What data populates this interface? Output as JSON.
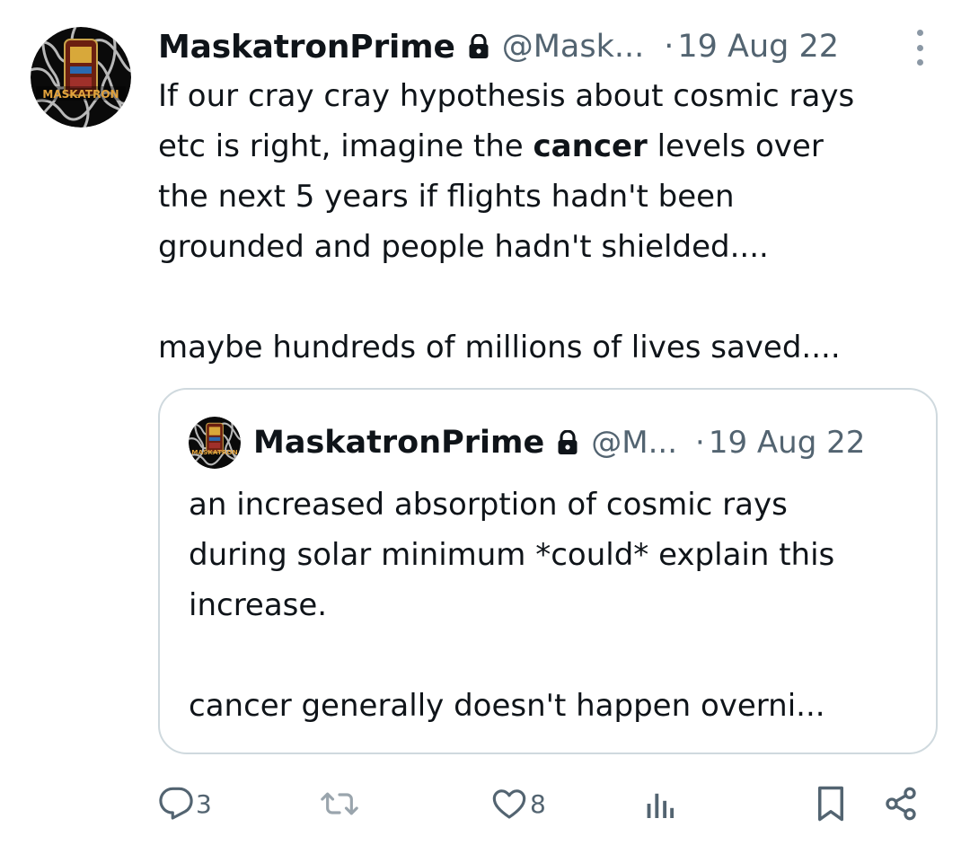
{
  "tweet": {
    "display_name": "MaskatronPrime",
    "handle": "@Mask...",
    "separator": "·",
    "date": "19 Aug 22",
    "avatar_text": "MASKATRON",
    "protected_icon": "lock-icon",
    "body": {
      "line1": "If our cray cray hypothesis about cosmic rays",
      "line2_pre": "etc is right, imagine the ",
      "line2_bold": "cancer",
      "line2_post": " levels over",
      "line3": "the next 5 years if flights hadn't been",
      "line4": "grounded and people hadn't shielded....",
      "line5": "maybe hundreds of millions of lives saved...."
    }
  },
  "quoted_tweet": {
    "display_name": "MaskatronPrime",
    "handle": "@M...",
    "separator": "·",
    "date": "19 Aug 22",
    "avatar_text": "MASKATRON",
    "body": {
      "line1": "an increased absorption of cosmic rays",
      "line2": "during solar minimum *could* explain this",
      "line3": "increase.",
      "line4": "cancer generally doesn't happen overni..."
    }
  },
  "actions": {
    "reply_count": "3",
    "retweet_count": "",
    "like_count": "8",
    "icons": [
      "reply-icon",
      "retweet-icon",
      "like-icon",
      "views-icon",
      "bookmark-icon",
      "share-icon"
    ]
  },
  "colors": {
    "text": "#0f1419",
    "secondary": "#536471",
    "border": "#cfd9de",
    "retweet_icon": "#9aa5ad"
  }
}
